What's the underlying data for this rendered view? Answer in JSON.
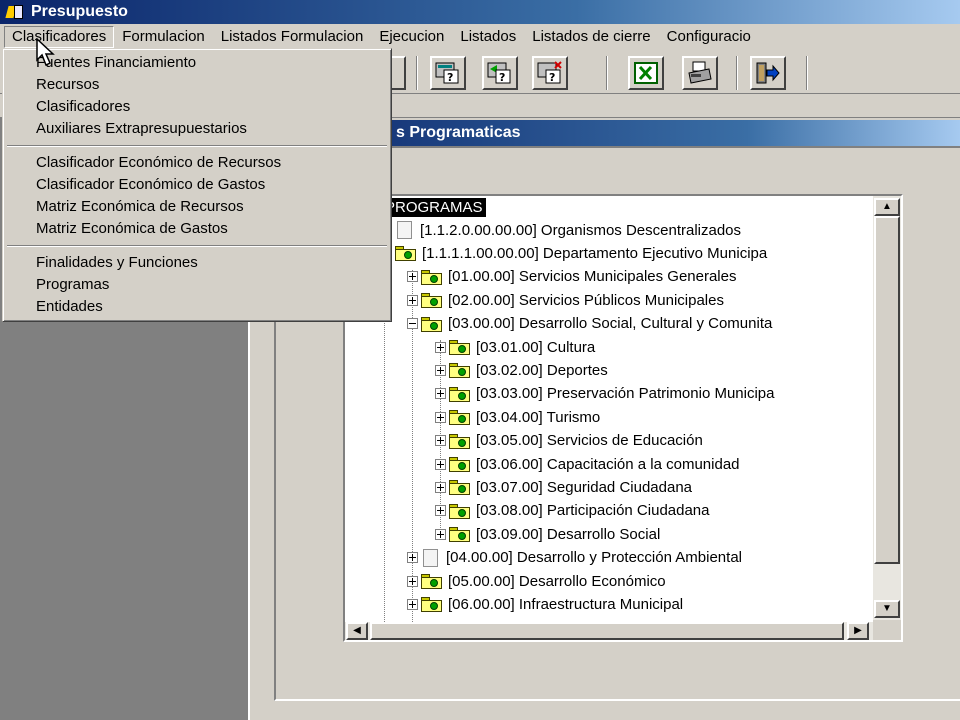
{
  "window": {
    "title": "Presupuesto"
  },
  "menubar": {
    "items": [
      {
        "label": "Clasificadores"
      },
      {
        "label": "Formulacion"
      },
      {
        "label": "Listados Formulacion"
      },
      {
        "label": "Ejecucion"
      },
      {
        "label": "Listados"
      },
      {
        "label": "Listados de cierre"
      },
      {
        "label": "Configuracio"
      }
    ]
  },
  "dropdown": {
    "groups": [
      [
        "Fuentes Financiamiento",
        "Recursos",
        "Clasificadores",
        "Auxiliares Extrapresupuestarios"
      ],
      [
        "Clasificador Económico de Recursos",
        "Clasificador Económico de Gastos",
        "Matriz Económica de Recursos",
        "Matriz Económica de Gastos"
      ],
      [
        "Finalidades y Funciones",
        "Programas",
        "Entidades"
      ]
    ]
  },
  "toolbar": {
    "icons": [
      "blank-button",
      "query-icon",
      "query-refresh-icon",
      "query-delete-icon",
      "excel-icon",
      "printer-icon",
      "exit-door-icon"
    ]
  },
  "child_window": {
    "title": "s Programaticas"
  },
  "tree": {
    "root": "PROGRAMAS",
    "nodes": [
      {
        "text": "[1.1.2.0.00.00.00] Organismos Descentralizados",
        "level": 0,
        "icon": "page",
        "expander": "none"
      },
      {
        "text": "[1.1.1.1.00.00.00] Departamento Ejecutivo Municipa",
        "level": 0,
        "icon": "folder",
        "expander": "minus"
      },
      {
        "text": "[01.00.00] Servicios Municipales Generales",
        "level": 1,
        "icon": "folder",
        "expander": "plus"
      },
      {
        "text": "[02.00.00] Servicios Públicos Municipales",
        "level": 1,
        "icon": "folder",
        "expander": "plus"
      },
      {
        "text": "[03.00.00] Desarrollo Social, Cultural y Comunita",
        "level": 1,
        "icon": "folder",
        "expander": "minus"
      },
      {
        "text": "[03.01.00] Cultura",
        "level": 2,
        "icon": "folder",
        "expander": "plus"
      },
      {
        "text": "[03.02.00] Deportes",
        "level": 2,
        "icon": "folder",
        "expander": "plus"
      },
      {
        "text": "[03.03.00] Preservación Patrimonio Municipa",
        "level": 2,
        "icon": "folder",
        "expander": "plus"
      },
      {
        "text": "[03.04.00] Turismo",
        "level": 2,
        "icon": "folder",
        "expander": "plus"
      },
      {
        "text": "[03.05.00] Servicios de Educación",
        "level": 2,
        "icon": "folder",
        "expander": "plus"
      },
      {
        "text": "[03.06.00] Capacitación a la comunidad",
        "level": 2,
        "icon": "folder",
        "expander": "plus"
      },
      {
        "text": "[03.07.00] Seguridad Ciudadana",
        "level": 2,
        "icon": "folder",
        "expander": "plus"
      },
      {
        "text": "[03.08.00] Participación Ciudadana",
        "level": 2,
        "icon": "folder",
        "expander": "plus"
      },
      {
        "text": "[03.09.00] Desarrollo Social",
        "level": 2,
        "icon": "folder",
        "expander": "plus"
      },
      {
        "text": "[04.00.00] Desarrollo y Protección Ambiental",
        "level": 1,
        "icon": "page",
        "expander": "plus"
      },
      {
        "text": "[05.00.00] Desarrollo Económico",
        "level": 1,
        "icon": "folder",
        "expander": "plus"
      },
      {
        "text": "[06.00.00] Infraestructura Municipal",
        "level": 1,
        "icon": "folder",
        "expander": "plus"
      }
    ]
  },
  "colors": {
    "titlebar": "#0a246a",
    "face": "#d4d0c8",
    "mdi_background": "#808080",
    "folder": "#ffff80"
  }
}
